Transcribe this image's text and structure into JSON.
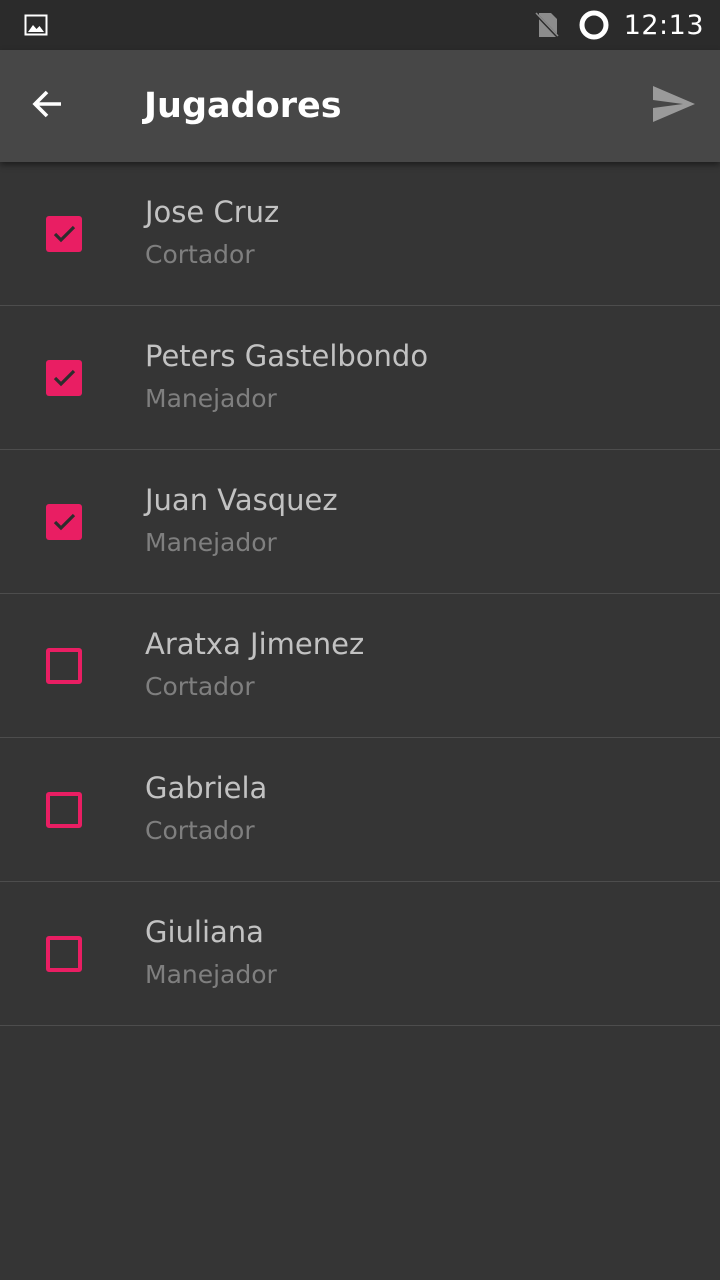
{
  "status_bar": {
    "time": "12:13",
    "icons": [
      "image-icon",
      "no-sim-icon",
      "sync-ring-icon"
    ]
  },
  "app_bar": {
    "title": "Jugadores",
    "back_icon": "arrow-back-icon",
    "send_icon": "send-icon"
  },
  "colors": {
    "accent": "#e91e63",
    "background": "#353535",
    "app_bar": "#474747",
    "status_bar": "#2b2b2b"
  },
  "players": [
    {
      "name": "Jose Cruz",
      "role": "Cortador",
      "checked": true
    },
    {
      "name": "Peters Gastelbondo",
      "role": "Manejador",
      "checked": true
    },
    {
      "name": "Juan Vasquez",
      "role": "Manejador",
      "checked": true
    },
    {
      "name": "Aratxa Jimenez",
      "role": "Cortador",
      "checked": false
    },
    {
      "name": "Gabriela",
      "role": "Cortador",
      "checked": false
    },
    {
      "name": "Giuliana",
      "role": "Manejador",
      "checked": false
    }
  ]
}
